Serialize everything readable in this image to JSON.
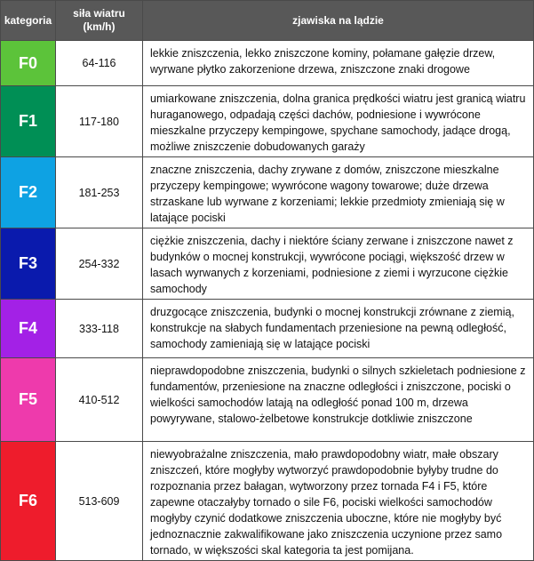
{
  "header": {
    "category": "kategoria",
    "wind_line1": "siła wiatru",
    "wind_line2": "(km/h)",
    "phenomena": "zjawiska na lądzie"
  },
  "colors": {
    "header_bg": "#585858",
    "F0": "#5cc33a",
    "F1": "#008f55",
    "F2": "#0ea2e3",
    "F3": "#0a1aad",
    "F4": "#a321e6",
    "F5": "#ee3aac",
    "F6": "#ee1c2c"
  },
  "rows": [
    {
      "category": "F0",
      "wind_speed": "64-116",
      "description": "lekkie zniszczenia, lekko zniszczone kominy, połamane gałęzie drzew, wyrwane płytko zakorzenione drzewa, zniszczone znaki drogowe"
    },
    {
      "category": "F1",
      "wind_speed": "117-180",
      "description": "umiarkowane zniszczenia, dolna granica prędkości wiatru jest granicą wiatru huraganowego, odpadają części dachów, podniesione i wywrócone mieszkalne przyczepy kempingowe, spychane samochody, jadące drogą, możliwe zniszczenie dobudowanych garaży"
    },
    {
      "category": "F2",
      "wind_speed": "181-253",
      "description": "znaczne zniszczenia, dachy zrywane z domów, zniszczone mieszkalne przyczepy kempingowe; wywrócone wagony towarowe; duże drzewa strzaskane lub wyrwane z korzeniami; lekkie przedmioty zmieniają się w latające pociski"
    },
    {
      "category": "F3",
      "wind_speed": "254-332",
      "description": "ciężkie zniszczenia, dachy i niektóre ściany zerwane i zniszczone nawet z budynków o mocnej konstrukcji, wywrócone pociągi, większość drzew w lasach wyrwanych z korzeniami, podniesione z ziemi i wyrzucone ciężkie samochody"
    },
    {
      "category": "F4",
      "wind_speed": "333-118",
      "description": "druzgocące zniszczenia, budynki o mocnej konstrukcji zrównane z ziemią, konstrukcje na słabych fundamentach przeniesione na pewną odległość, samochody zamieniają się w latające pociski"
    },
    {
      "category": "F5",
      "wind_speed": "410-512",
      "description": "nieprawdopodobne zniszczenia, budynki o silnych szkieletach podniesione z fundamentów, przeniesione na znaczne odległości i zniszczone, pociski o wielkości samochodów latają na odległość ponad 100 m, drzewa powyrywane, stalowo-żelbetowe konstrukcje dotkliwie zniszczone"
    },
    {
      "category": "F6",
      "wind_speed": "513-609",
      "description": "niewyobrażalne zniszczenia, mało prawdopodobny wiatr, małe obszary zniszczeń, które mogłyby wytworzyć prawdopodobnie byłyby trudne do rozpoznania przez bałagan, wytworzony przez tornada F4 i F5, które zapewne otaczałyby tornado o sile F6, pociski wielkości samochodów mogłyby czynić dodatkowe zniszczenia uboczne, które nie mogłyby być jednoznacznie zakwalifikowane jako zniszczenia uczynione przez samo tornado, w większości skal kategoria ta jest pomijana."
    }
  ]
}
